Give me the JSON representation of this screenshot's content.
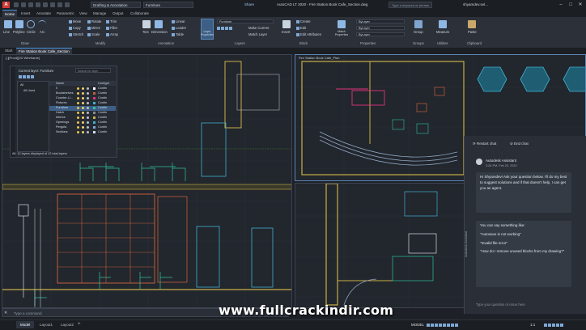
{
  "app": {
    "logo": "A",
    "title": "AutoCAD LT 2020 - Fire Station Book Cafe_Section.dwg"
  },
  "workspace": "Drafting & Annotation",
  "quick_layer": "Furniture",
  "share_label": "Share",
  "search": {
    "placeholder": "Type a keyword or phrase"
  },
  "user": "shyamdev.sel...",
  "window_controls": {
    "min": "–",
    "max": "□",
    "close": "✕"
  },
  "ribbon_tabs": [
    "Home",
    "Insert",
    "Annotate",
    "Parametric",
    "View",
    "Manage",
    "Output",
    "Collaborate"
  ],
  "ribbon": {
    "draw": {
      "items": [
        "Line",
        "Polyline",
        "Circle",
        "Arc"
      ],
      "label": "Draw"
    },
    "modify": {
      "items": [
        "Move",
        "Rotate",
        "Trim",
        "Copy",
        "Mirror",
        "Fillet",
        "Stretch",
        "Scale",
        "Array"
      ],
      "label": "Modify"
    },
    "annotation": {
      "items": [
        "Text",
        "Dimension",
        "Linear",
        "Leader",
        "Table"
      ],
      "label": "Annotation"
    },
    "layers": {
      "big": "Layer Properties",
      "combo": "Furniture",
      "items": [
        "Make Current",
        "Match Layer"
      ],
      "label": "Layers"
    },
    "block": {
      "big": "Insert",
      "items": [
        "Create",
        "Edit",
        "Edit Attributes"
      ],
      "label": "Block"
    },
    "properties": {
      "big": "Match Properties",
      "combos": [
        "ByLayer",
        "ByLayer",
        "ByLayer"
      ],
      "label": "Properties"
    },
    "groups": {
      "big": "Group",
      "label": "Groups"
    },
    "utilities": {
      "big": "Measure",
      "label": "Utilities"
    },
    "clipboard": {
      "big": "Paste",
      "label": "Clipboard"
    }
  },
  "doc_tabs": [
    "Start",
    "Fire Station Book Cafe_Section"
  ],
  "viewport_left": {
    "header": "[-][Front][2D Wireframe]"
  },
  "viewport_right": {
    "header": "Fire Station Book Cafe_Plan"
  },
  "layer_manager": {
    "title": "Current layer: Furniture",
    "search_placeholder": "Search for layer",
    "columns": [
      "Name",
      "On",
      "Freeze",
      "Lock",
      "Color",
      "Linetype"
    ],
    "layers": [
      "0",
      "Bookshelves",
      "Counter-Li...",
      "Fixtures",
      "Furniture",
      "Hatch",
      "Interior",
      "Openings",
      "Pergola",
      "Sections"
    ],
    "footer": "All: 12 layers displayed of 12 total layers",
    "tree": [
      "All",
      "All Used"
    ]
  },
  "chat": {
    "actions": [
      "Restart chat",
      "End chat"
    ],
    "agent": "Autodesk Assistant",
    "time": "3:26 PM, Feb 20, 2020",
    "greeting": "Hi Shyamdev! Ask your question below. I'll do my best to suggest solutions and if that doesn't help, I can get you an agent.",
    "suggest_intro": "You can say something like:",
    "suggestions": [
      "\"Autosave is not working\"",
      "\"Invalid file error\"",
      "\"How do I remove unused blocks from my drawing?\""
    ],
    "input_placeholder": "Type your question or issue here",
    "side_label": "Autodesk Assistant"
  },
  "command_line": {
    "placeholder": "Type a command"
  },
  "status": {
    "tabs": [
      "Model",
      "Layout1",
      "Layout2"
    ],
    "mode": "MODEL",
    "scale": "1:1"
  },
  "watermark": "www.fullcrackindir.com"
}
